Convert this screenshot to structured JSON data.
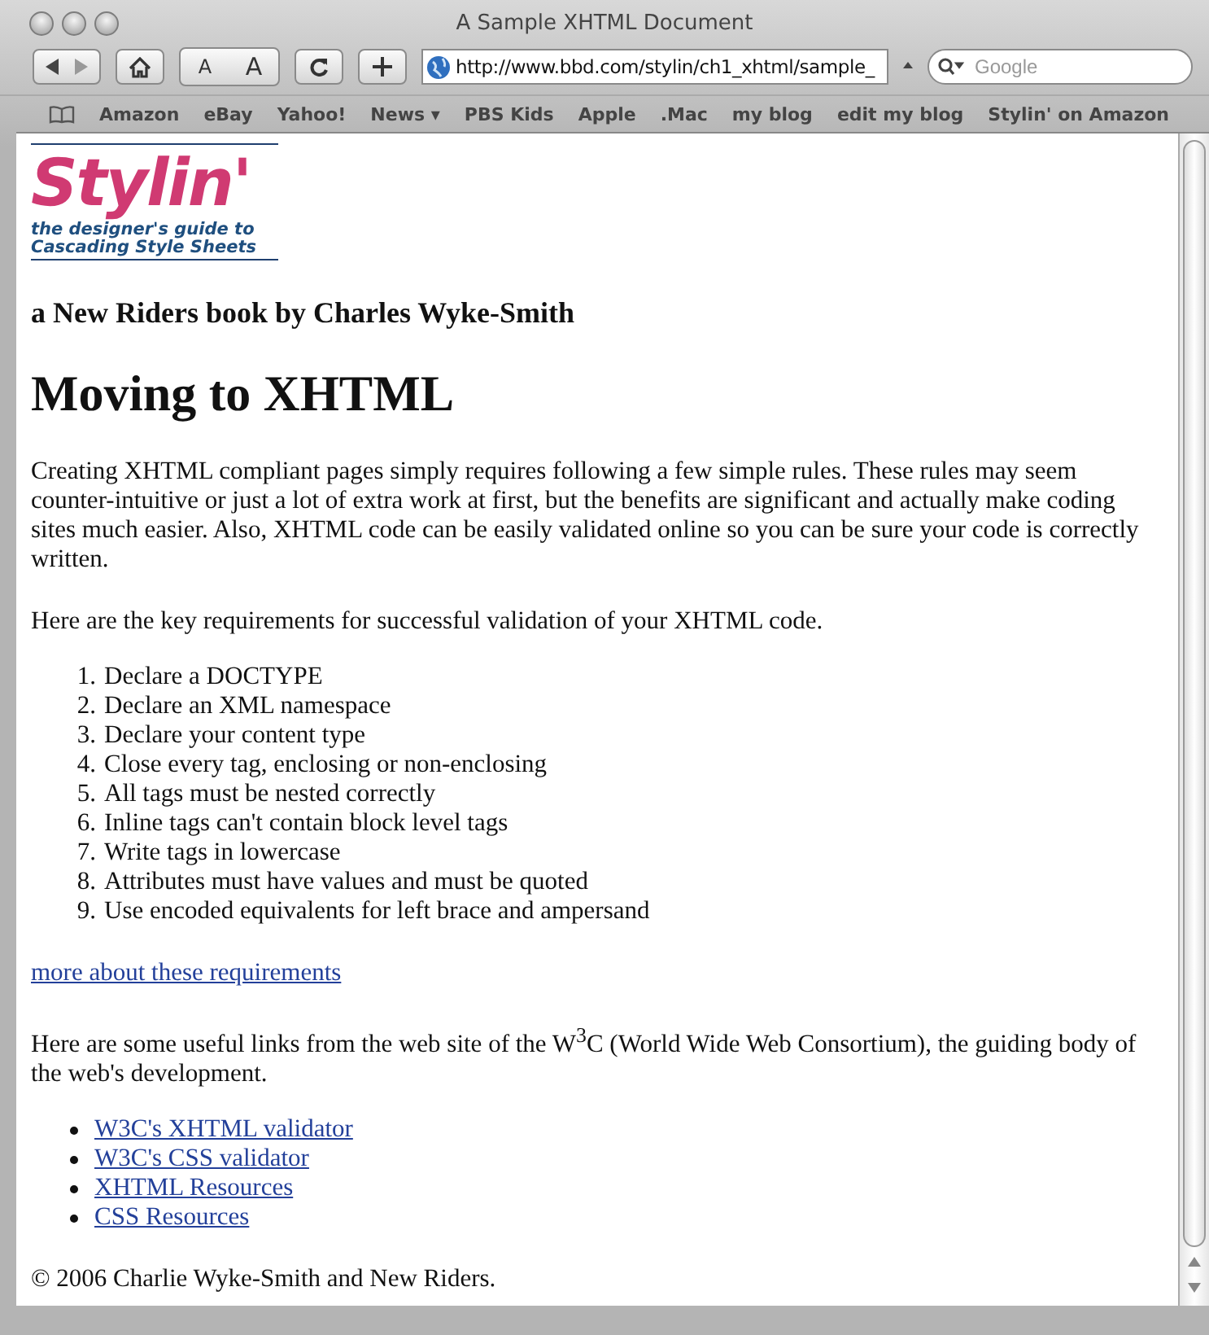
{
  "window": {
    "title": "A Sample XHTML Document"
  },
  "toolbar": {
    "text_size_buttons": [
      "A",
      "A"
    ],
    "address": "http://www.bbd.com/stylin/ch1_xhtml/sample_",
    "search": {
      "placeholder": "Google"
    }
  },
  "bookmarks": [
    "Amazon",
    "eBay",
    "Yahoo!",
    "News ▾",
    "PBS Kids",
    "Apple",
    ".Mac",
    "my blog",
    "edit my blog",
    "Stylin' on Amazon"
  ],
  "page": {
    "logo": {
      "title": "Stylin'",
      "tagline": [
        "the designer's guide to",
        "Cascading Style Sheets"
      ]
    },
    "byline": "a New Riders book by Charles Wyke-Smith",
    "heading": "Moving to XHTML",
    "intro": "Creating XHTML compliant pages simply requires following a few simple rules. These rules may seem counter-intuitive or just a lot of extra work at first, but the benefits are significant and actually make coding sites much easier. Also, XHTML code can be easily validated online so you can be sure your code is correctly written.",
    "lead": "Here are the key requirements for successful validation of your XHTML code.",
    "requirements": [
      {
        "number": "1.",
        "text": "Declare a DOCTYPE"
      },
      {
        "number": "2.",
        "text": "Declare an XML namespace"
      },
      {
        "number": "3.",
        "text": "Declare your content type"
      },
      {
        "number": "4.",
        "text": "Close every tag, enclosing or non-enclosing"
      },
      {
        "number": "5.",
        "text": "All tags must be nested correctly"
      },
      {
        "number": "6.",
        "text": "Inline tags can't contain block level tags"
      },
      {
        "number": "7.",
        "text": "Write tags in lowercase"
      },
      {
        "number": "8.",
        "text": "Attributes must have values and must be quoted"
      },
      {
        "number": "9.",
        "text": "Use encoded equivalents for left brace and ampersand"
      }
    ],
    "more_link": "more about these requirements",
    "links_intro": "Here are some useful links from the web site of the W$^{3}$C (World Wide Web Consortium), the guiding body of the web's development.",
    "links": [
      "W3C's XHTML validator",
      "W3C's CSS validator",
      "XHTML Resources",
      "CSS Resources"
    ],
    "footer": "© 2006 Charlie Wyke-Smith and New Riders."
  }
}
